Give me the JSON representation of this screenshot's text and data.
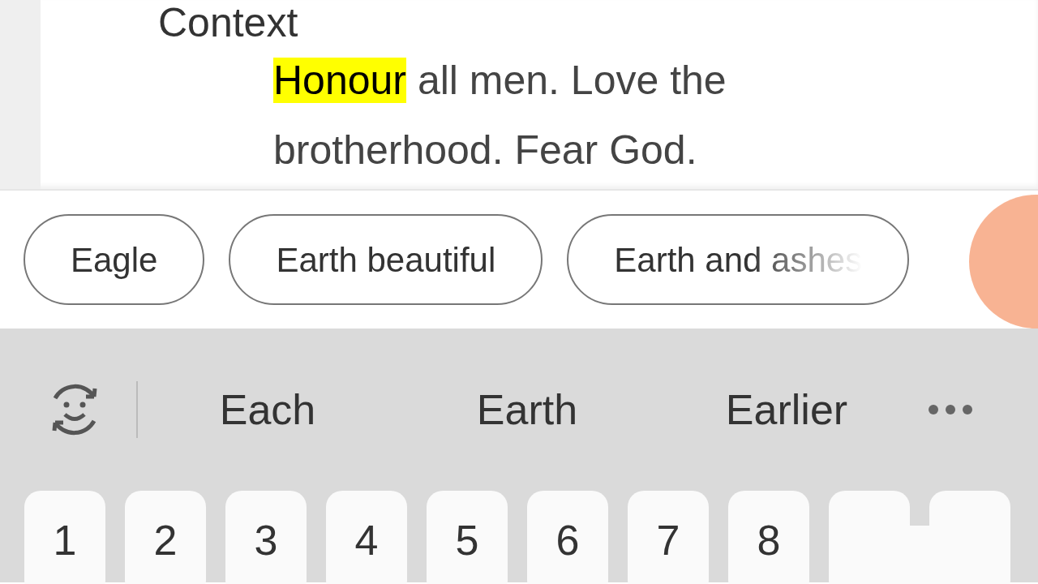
{
  "context": {
    "heading": "Context",
    "parts": [
      {
        "text": "Honour",
        "highlighted": true
      },
      {
        "text": " all men. Love the brotherhood. Fear God.",
        "highlighted": false
      }
    ]
  },
  "chips": [
    {
      "label": "Eagle",
      "faded": false
    },
    {
      "label": "Earth beautiful",
      "faded": false
    },
    {
      "label": "Earth and ashes",
      "faded": true
    }
  ],
  "suggestions": [
    "Each",
    "Earth",
    "Earlier"
  ],
  "keys": [
    {
      "label": "1"
    },
    {
      "label": "2"
    },
    {
      "label": "3"
    },
    {
      "label": "4"
    },
    {
      "label": "5"
    },
    {
      "label": "6"
    },
    {
      "label": "7"
    },
    {
      "label": "8"
    }
  ]
}
